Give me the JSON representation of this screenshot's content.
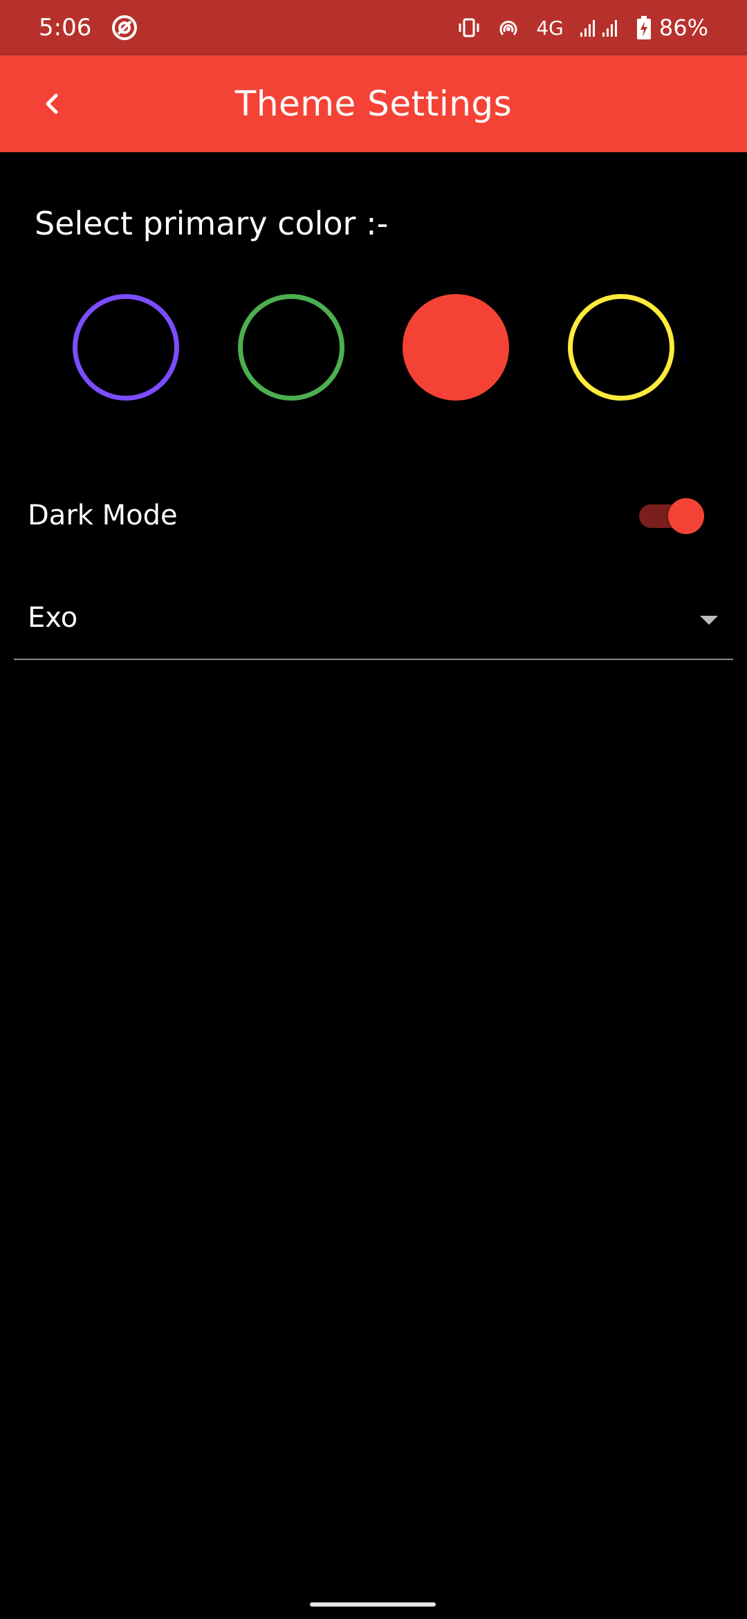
{
  "status_bar": {
    "time": "5:06",
    "network": "4G",
    "battery": "86%",
    "icons": [
      "sync-icon",
      "vibrate-icon",
      "hotspot-icon",
      "signal-icon",
      "battery-charging-icon"
    ]
  },
  "app_bar": {
    "title": "Theme Settings",
    "back_icon": "chevron-left-icon"
  },
  "theme": {
    "section_label": "Select primary color :-",
    "colors": [
      {
        "name": "purple",
        "hex": "#7c4dff",
        "selected": false
      },
      {
        "name": "green",
        "hex": "#4caf50",
        "selected": false
      },
      {
        "name": "red",
        "hex": "#f44336",
        "selected": true
      },
      {
        "name": "yellow",
        "hex": "#ffeb3b",
        "selected": false
      }
    ],
    "dark_mode": {
      "label": "Dark Mode",
      "enabled": true
    },
    "font": {
      "selected": "Exo"
    }
  },
  "colors": {
    "status_bar_bg": "#b7312c",
    "app_bar_bg": "#f44336",
    "background": "#000000",
    "accent": "#f44336"
  }
}
